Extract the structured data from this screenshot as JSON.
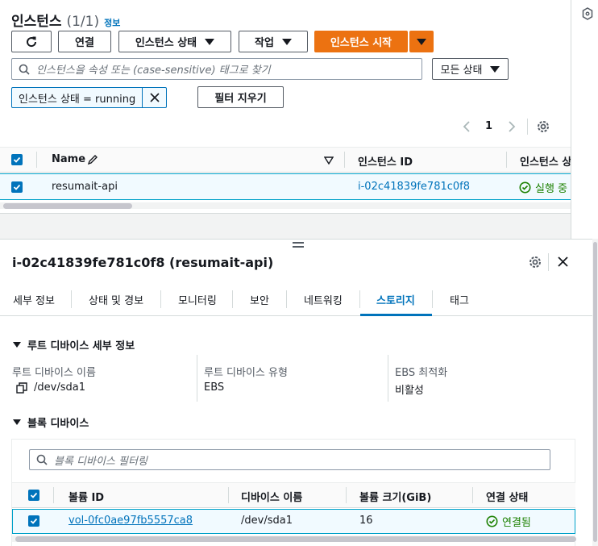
{
  "instances": {
    "title": "인스턴스",
    "count": "(1/1)",
    "info_link": "정보",
    "buttons": {
      "connect": "연결",
      "instance_state": "인스턴스 상태",
      "actions": "작업",
      "launch": "인스턴스 시작"
    },
    "search_placeholder": "인스턴스을 속성 또는 (case-sensitive) 태그로 찾기",
    "state_filter": "모든 상태",
    "filter_token": "인스턴스 상태 = running",
    "clear_filters": "필터 지우기",
    "pagination": {
      "page": "1"
    },
    "columns": [
      "Name",
      "인스턴스 ID",
      "인스턴스 상"
    ],
    "rows": [
      {
        "name": "resumait-api",
        "instance_id": "i-02c41839fe781c0f8",
        "state": "실행 중"
      }
    ]
  },
  "detail": {
    "title": "i-02c41839fe781c0f8 (resumait-api)",
    "tabs": [
      "세부 정보",
      "상태 및 경보",
      "모니터링",
      "보안",
      "네트워킹",
      "스토리지",
      "태그"
    ],
    "active_tab": "스토리지",
    "root_device": {
      "heading": "루트 디바이스 세부 정보",
      "name_label": "루트 디바이스 이름",
      "name_value": "/dev/sda1",
      "type_label": "루트 디바이스 유형",
      "type_value": "EBS",
      "ebs_label": "EBS 최적화",
      "ebs_value": "비활성"
    },
    "block_devices": {
      "heading": "블록 디바이스",
      "search_placeholder": "블록 디바이스 필터링",
      "columns": [
        "볼륨 ID",
        "디바이스 이름",
        "볼륨 크기(GiB)",
        "연결 상태"
      ],
      "rows": [
        {
          "volume_id": "vol-0fc0ae97fb5557ca8",
          "device": "/dev/sda1",
          "size": "16",
          "state": "연결됨"
        }
      ]
    }
  },
  "colors": {
    "accent": "#0073bb",
    "primary_button": "#ec7211",
    "success": "#1d8102"
  }
}
